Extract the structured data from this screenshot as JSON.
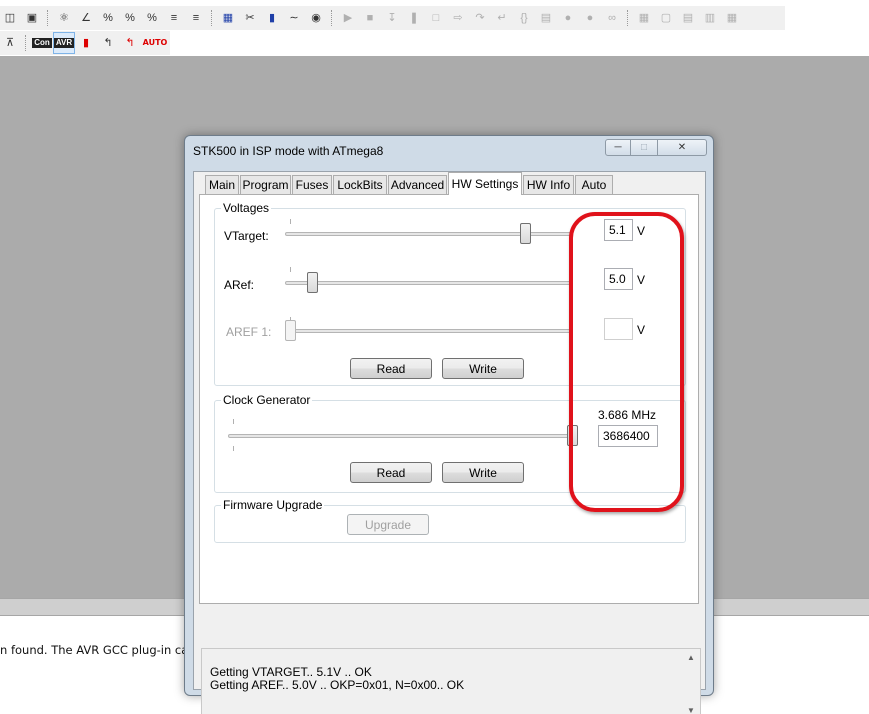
{
  "toolbar_primary": {
    "icons": [
      "windows-icon",
      "connect-icon",
      "find-icon",
      "tool-1-icon",
      "tool-2-icon",
      "tool-3-icon",
      "tool-4-icon",
      "indent-icon",
      "outdent-icon",
      "board-icon",
      "cut-tool-icon",
      "chip-icon",
      "ac-icon",
      "bug-icon",
      "run-icon",
      "stop-icon",
      "step-icon",
      "pause-icon",
      "reset-icon",
      "next-icon",
      "step-over-icon",
      "step-out-icon",
      "braces-icon",
      "watch-icon",
      "breakpoint-icon",
      "clear-breakpoints-icon",
      "trace-icon",
      "window-1-icon",
      "window-2-icon",
      "window-3-icon",
      "window-4-icon",
      "window-5-icon"
    ]
  },
  "toolbar_secondary": {
    "icons": [
      "upload-icon",
      "con-icon",
      "avr-icon",
      "chip-red-icon",
      "wire-icon",
      "wire-red-icon"
    ],
    "labels": {
      "con": "Con",
      "avr": "AVR",
      "auto": "AUTO"
    }
  },
  "output": {
    "text": "n found. The AVR GCC plug-in can"
  },
  "dialog": {
    "title": "STK500 in ISP mode with ATmega8",
    "tabs": [
      {
        "label": "Main",
        "active": false
      },
      {
        "label": "Program",
        "active": false
      },
      {
        "label": "Fuses",
        "active": false
      },
      {
        "label": "LockBits",
        "active": false
      },
      {
        "label": "Advanced",
        "active": false
      },
      {
        "label": "HW Settings",
        "active": true
      },
      {
        "label": "HW Info",
        "active": false
      },
      {
        "label": "Auto",
        "active": false
      }
    ],
    "voltages": {
      "title": "Voltages",
      "vtarget": {
        "label": "VTarget:",
        "value": "5.1",
        "unit": "V",
        "slider_fraction": 0.85
      },
      "aref": {
        "label": "ARef:",
        "value": "5.0",
        "unit": "V",
        "slider_fraction": 0.08
      },
      "aref1": {
        "label": "AREF 1:",
        "value": "",
        "unit": "V",
        "slider_fraction": 0.0,
        "enabled": false
      },
      "read_label": "Read",
      "write_label": "Write"
    },
    "clock": {
      "title": "Clock Generator",
      "frequency": "3.686 MHz",
      "value": "3686400",
      "slider_fraction": 1.0,
      "read_label": "Read",
      "write_label": "Write"
    },
    "firmware": {
      "title": "Firmware Upgrade",
      "upgrade_label": "Upgrade"
    },
    "log": [
      "Getting VTARGET.. 5.1V .. OK",
      "Getting AREF.. 5.0V .. OKP=0x01, N=0x00.. OK"
    ]
  },
  "colors": {
    "annotation": "#e0121b",
    "workspace": "#ababab",
    "dialog_frame": "#cfdbe7"
  }
}
